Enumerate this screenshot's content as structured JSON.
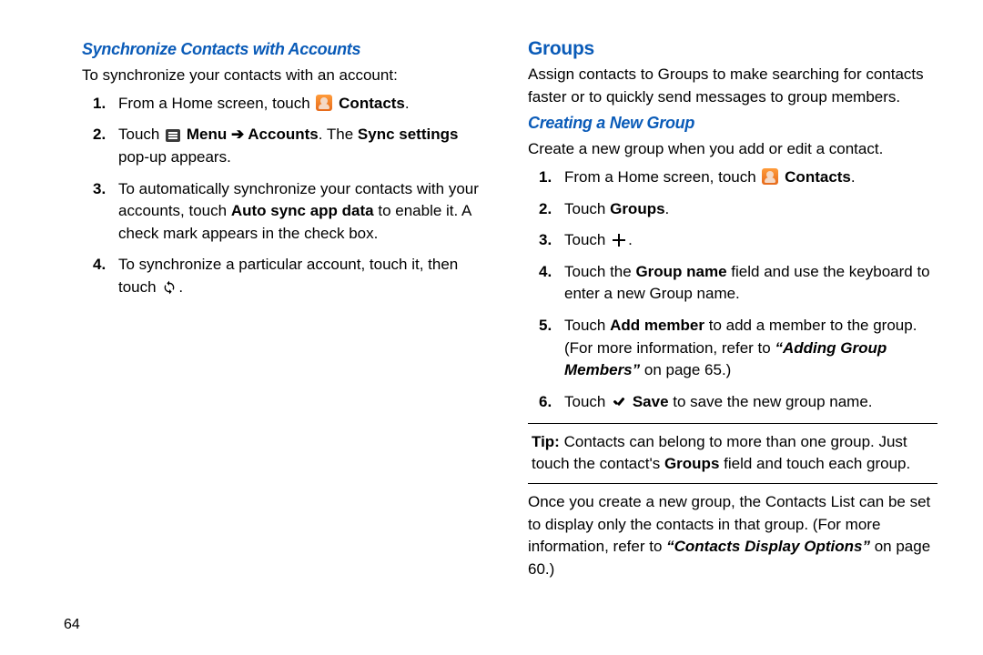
{
  "pageNumber": "64",
  "left": {
    "heading": "Synchronize Contacts with Accounts",
    "intro": "To synchronize your contacts with an account:",
    "steps": {
      "s1_a": "From a Home screen, touch ",
      "s1_b": "Contacts",
      "s1_c": ".",
      "s2_a": "Touch ",
      "s2_menu": "Menu",
      "s2_arrow": " ➔ ",
      "s2_accounts": "Accounts",
      "s2_b": ". The ",
      "s2_sync": "Sync settings",
      "s2_c": " pop-up appears.",
      "s3_a": "To automatically synchronize your contacts with your accounts, touch ",
      "s3_b": "Auto sync app data",
      "s3_c": " to enable it. A check mark appears in the check box.",
      "s4_a": "To synchronize a particular account, touch it, then touch ",
      "s4_b": "."
    }
  },
  "right": {
    "h2": "Groups",
    "intro": "Assign contacts to Groups to make searching for contacts faster or to quickly send messages to group members.",
    "subhead": "Creating a New Group",
    "createIntro": "Create a new group when you add or edit a contact.",
    "steps": {
      "s1_a": "From a Home screen, touch ",
      "s1_b": "Contacts",
      "s1_c": ".",
      "s2_a": "Touch ",
      "s2_b": "Groups",
      "s2_c": ".",
      "s3_a": "Touch ",
      "s3_b": ".",
      "s4_a": "Touch the ",
      "s4_b": "Group name",
      "s4_c": " field and use the keyboard to enter a new Group name.",
      "s5_a": "Touch ",
      "s5_b": "Add member",
      "s5_c": " to add a member to the group. (For more information, refer to ",
      "s5_ref": "“Adding Group Members”",
      "s5_d": " on page 65.)",
      "s6_a": "Touch ",
      "s6_b": "Save",
      "s6_c": " to save the new group name."
    },
    "tip_lead": "Tip:",
    "tip_body_a": " Contacts can belong to more than one group. Just touch the contact's ",
    "tip_body_b": "Groups",
    "tip_body_c": " field and touch each group.",
    "after_a": "Once you create a new group, the Contacts List can be set to display only the contacts in that group. (For more information, refer to ",
    "after_ref": "“Contacts Display Options”",
    "after_b": "  on page 60.)"
  }
}
